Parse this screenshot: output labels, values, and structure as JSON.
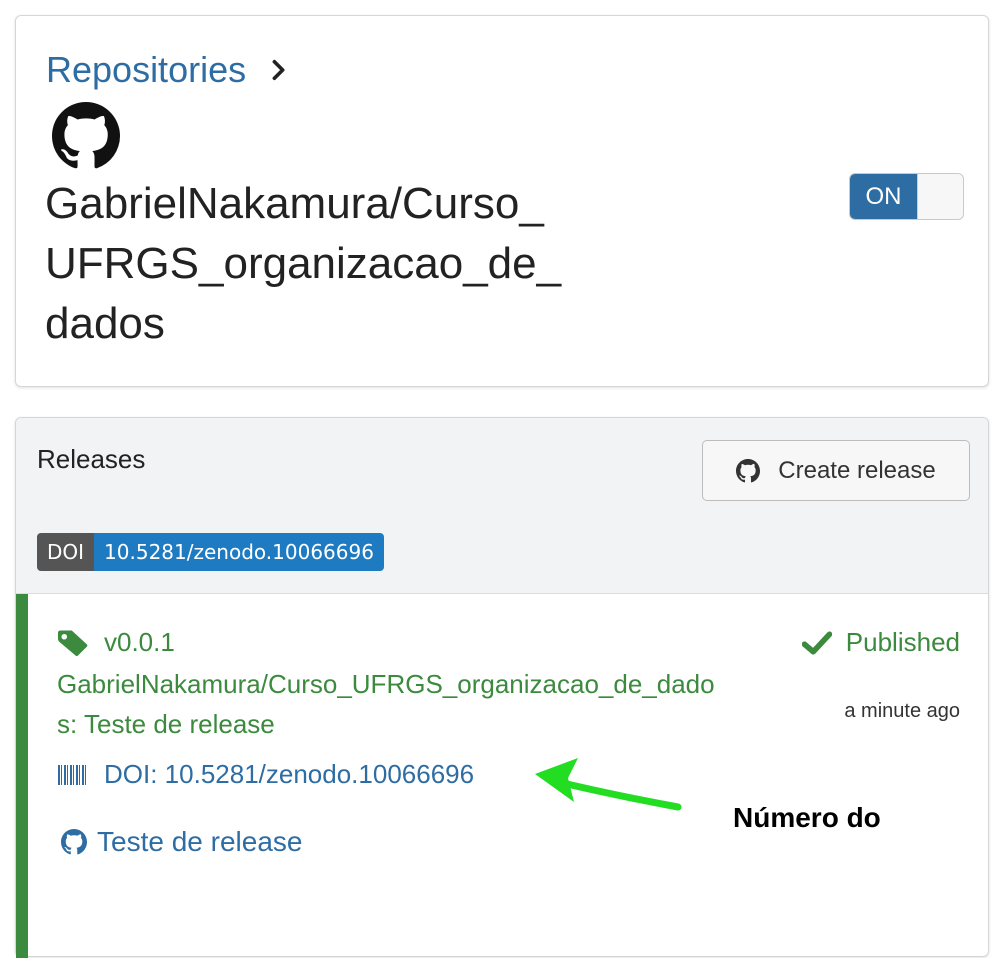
{
  "repo": {
    "breadcrumb_label": "Repositories",
    "name": "GabrielNakamura/Curso_UFRGS_organizacao_de_dados",
    "toggle_label": "ON"
  },
  "releases": {
    "title": "Releases",
    "create_button_label": "Create release",
    "badge_left": "DOI",
    "badge_right": "10.5281/zenodo.10066696",
    "items": [
      {
        "version": "v0.0.1",
        "title": "GabrielNakamura/Curso_UFRGS_organizacao_de_dados: Teste de release",
        "status": "Published",
        "time": "a minute ago",
        "doi": "DOI: 10.5281/zenodo.10066696",
        "github_link": "Teste de release"
      }
    ]
  },
  "annotation": {
    "text": "Número do"
  },
  "colors": {
    "link": "#2e6da4",
    "success": "#3c8a3e",
    "badge_blue": "#1f7bc1",
    "annotation_green": "#22dd22"
  },
  "icons": [
    "chevron-right-icon",
    "github-icon",
    "tag-icon",
    "check-icon",
    "barcode-icon"
  ]
}
